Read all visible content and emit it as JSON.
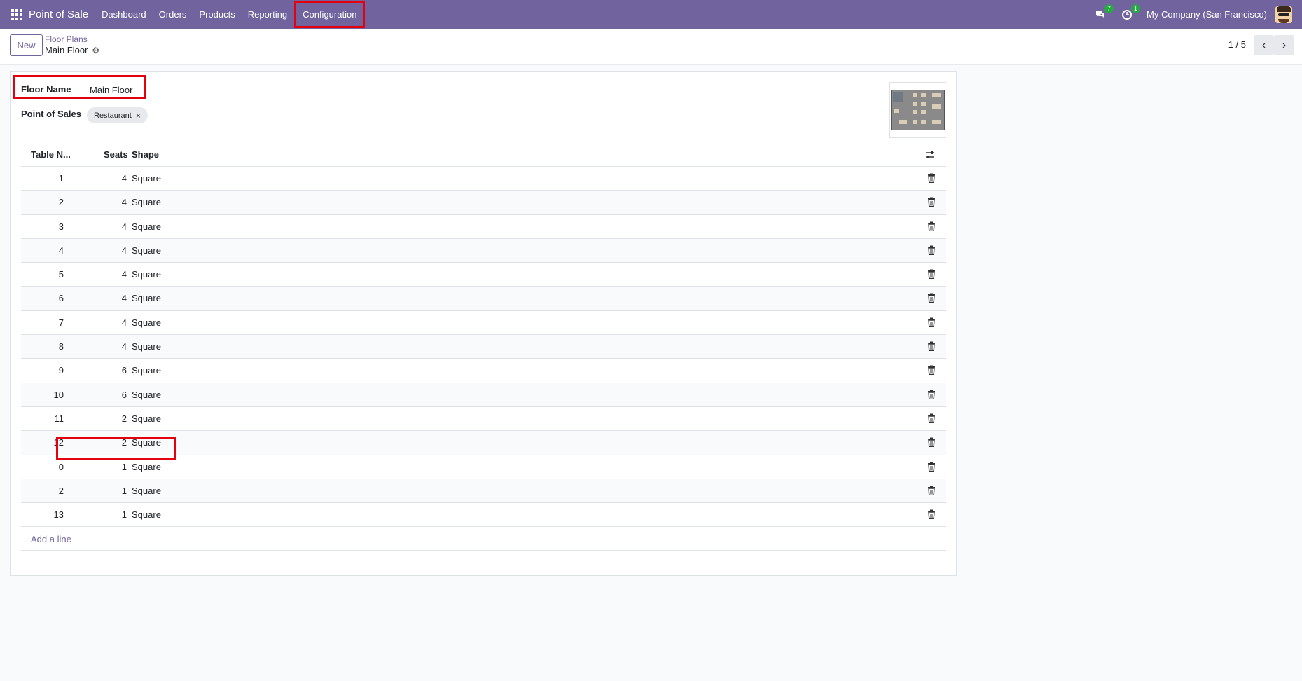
{
  "nav": {
    "brand": "Point of Sale",
    "menu": [
      "Dashboard",
      "Orders",
      "Products",
      "Reporting",
      "Configuration"
    ],
    "messages_count": "7",
    "activities_count": "1",
    "company": "My Company (San Francisco)"
  },
  "control": {
    "new_label": "New",
    "breadcrumb_parent": "Floor Plans",
    "breadcrumb_current": "Main Floor",
    "pager": "1 / 5"
  },
  "form": {
    "floor_name_label": "Floor Name",
    "floor_name_value": "Main Floor",
    "pos_label": "Point of Sales",
    "pos_tag": "Restaurant"
  },
  "table": {
    "headers": [
      "Table N...",
      "Seats",
      "Shape"
    ],
    "rows": [
      {
        "num": "1",
        "seats": "4",
        "shape": "Square"
      },
      {
        "num": "2",
        "seats": "4",
        "shape": "Square"
      },
      {
        "num": "3",
        "seats": "4",
        "shape": "Square"
      },
      {
        "num": "4",
        "seats": "4",
        "shape": "Square"
      },
      {
        "num": "5",
        "seats": "4",
        "shape": "Square"
      },
      {
        "num": "6",
        "seats": "4",
        "shape": "Square"
      },
      {
        "num": "7",
        "seats": "4",
        "shape": "Square"
      },
      {
        "num": "8",
        "seats": "4",
        "shape": "Square"
      },
      {
        "num": "9",
        "seats": "6",
        "shape": "Square"
      },
      {
        "num": "10",
        "seats": "6",
        "shape": "Square"
      },
      {
        "num": "11",
        "seats": "2",
        "shape": "Square"
      },
      {
        "num": "12",
        "seats": "2",
        "shape": "Square"
      },
      {
        "num": "0",
        "seats": "1",
        "shape": "Square"
      },
      {
        "num": "2",
        "seats": "1",
        "shape": "Square"
      },
      {
        "num": "13",
        "seats": "1",
        "shape": "Square"
      }
    ],
    "add_line": "Add a line"
  },
  "colors": {
    "brand": "#71639e",
    "highlight": "#e3000f"
  }
}
